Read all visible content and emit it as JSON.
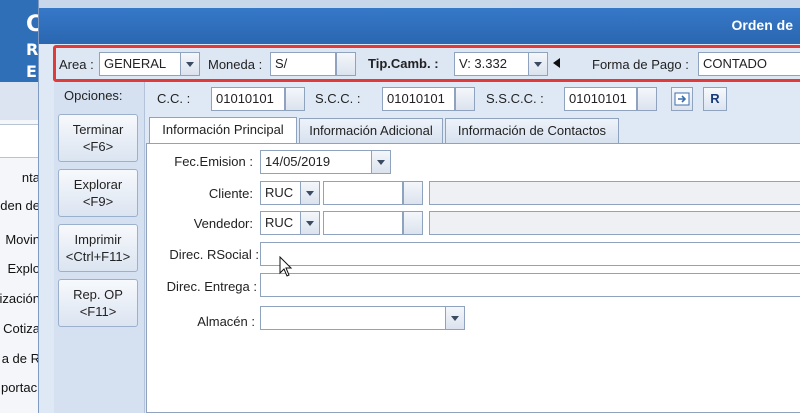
{
  "background_app": {
    "header_letters": [
      "C",
      "R",
      "E"
    ],
    "items": [
      "nta",
      "rden de",
      "Movin",
      "Explo",
      "tización",
      "Cotiza",
      "a de R",
      "portaci"
    ]
  },
  "window": {
    "banner_title": "Orden de",
    "toolbar": {
      "area_label": "Area :",
      "area_value": "GENERAL",
      "moneda_label": "Moneda :",
      "moneda_value": "S/",
      "tipcamb_label": "Tip.Camb. :",
      "tipcamb_value": "V: 3.332",
      "forma_pago_label": "Forma de Pago :",
      "forma_pago_value": "CONTADO"
    },
    "options": {
      "header": "Opciones:",
      "buttons": [
        {
          "line1": "Terminar",
          "line2": "<F6>"
        },
        {
          "line1": "Explorar",
          "line2": "<F9>"
        },
        {
          "line1": "Imprimir",
          "line2": "<Ctrl+F11>"
        },
        {
          "line1": "Rep. OP",
          "line2": "<F11>"
        }
      ]
    },
    "cost_centers": {
      "cc_label": "C.C. :",
      "cc_value": "01010101",
      "scc_label": "S.C.C. :",
      "scc_value": "01010101",
      "sscc_label": "S.S.C.C. :",
      "sscc_value": "01010101",
      "r_button": "R"
    },
    "tabs": [
      "Información Principal",
      "Información Adicional",
      "Información de Contactos"
    ],
    "form": {
      "fec_emision_label": "Fec.Emision :",
      "fec_emision_value": "14/05/2019",
      "cliente_label": "Cliente:",
      "cliente_doc_type": "RUC",
      "vendedor_label": "Vendedor:",
      "vendedor_doc_type": "RUC",
      "direc_rsocial_label": "Direc. RSocial :",
      "direc_entrega_label": "Direc. Entrega :",
      "almacen_label": "Almacén :"
    }
  }
}
